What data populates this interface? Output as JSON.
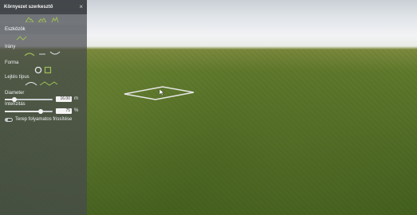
{
  "panel": {
    "title": "Környezet szerkesztő",
    "close_glyph": "×",
    "tools_tab": "Eszközök",
    "direction_label": "Irány",
    "shape_label": "Forma",
    "slope_label": "Lejtés típus",
    "diameter_label": "Diameter",
    "diameter_value": "16.00",
    "diameter_unit": "m",
    "diameter_level": 0.2,
    "intensity_label": "Intenzitás",
    "intensity_value": "75",
    "intensity_unit": "%",
    "intensity_level": 0.75,
    "terrain_update_label": "Terep folyamatos frissítése",
    "terrain_update_enabled": false
  },
  "icons": {
    "close": "close-icon",
    "tool_raise": "mountain-raise-icon",
    "tool_lower": "mountain-lower-icon",
    "tool_flatten": "flatten-icon",
    "dir_up": "direction-up-icon",
    "dir_down": "direction-down-icon",
    "shape_circle": "circle-shape-icon",
    "shape_square": "square-shape-icon",
    "slope_smooth": "slope-smooth-icon",
    "slope_linear": "slope-linear-icon"
  },
  "colors": {
    "accent_green": "#9fbf55",
    "panel_bg": "#464a4e",
    "selection_outline": "#e6e6e6"
  }
}
